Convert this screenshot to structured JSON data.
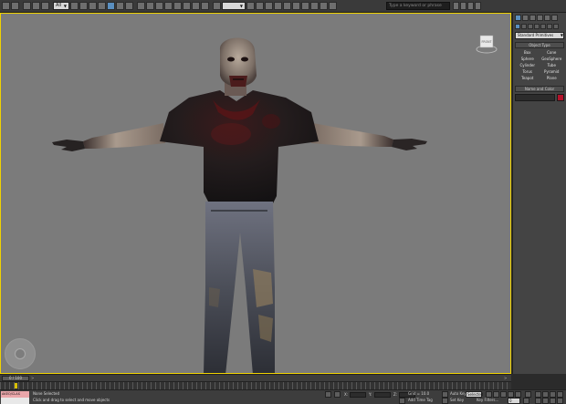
{
  "toolbar": {
    "selection_filter": "All",
    "search_placeholder": "Type a keyword or phrase"
  },
  "viewport": {
    "viewcube_label": "FRONT"
  },
  "command_panel": {
    "category_dropdown": "Standard Primitives",
    "object_type_title": "Object Type",
    "objects": [
      "Box",
      "Cone",
      "Sphere",
      "GeoSphere",
      "Cylinder",
      "Tube",
      "Torus",
      "Pyramid",
      "Teapot",
      "Plane"
    ],
    "name_color_title": "Name and Color",
    "swatch_color": "#b4122a"
  },
  "timeslider": {
    "frame_display": "0 / 100",
    "prev_arrow": "<",
    "next_arrow": ">"
  },
  "statusbar": {
    "maxscript_line1": "AKEO/CLAS",
    "maxscript_line2": "",
    "status_line1": "None Selected",
    "status_line2": "Click and drag to select and move objects",
    "x_label": "X:",
    "y_label": "Y:",
    "z_label": "Z:",
    "grid_text": "Grid = 10.0",
    "add_time_tag": "Add Time Tag",
    "auto_key": "Auto Key",
    "set_key": "Set Key",
    "key_mode": "Selected",
    "key_filters": "Key Filters...",
    "frame_field": "0"
  }
}
